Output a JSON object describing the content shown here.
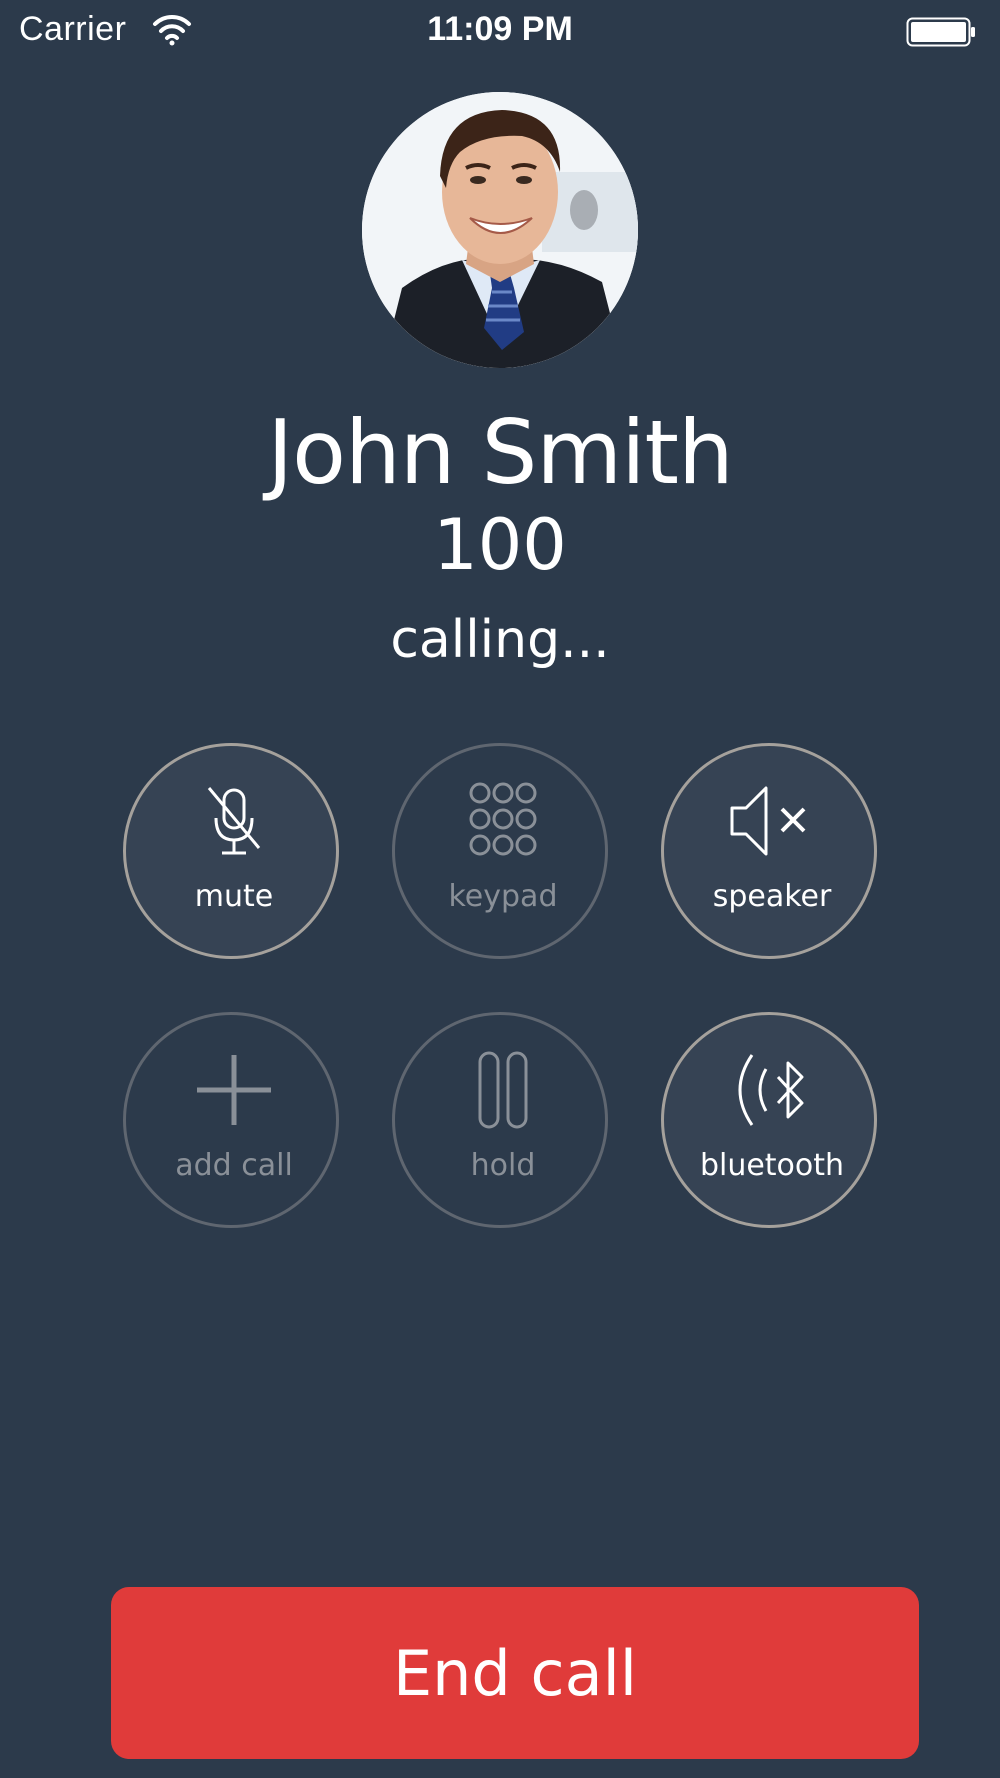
{
  "status_bar": {
    "carrier": "Carrier",
    "time": "11:09 PM",
    "wifi_icon": "wifi-icon",
    "battery_icon": "battery-full-icon"
  },
  "caller": {
    "name": "John Smith",
    "number": "100",
    "status": "calling..."
  },
  "controls": {
    "mute": {
      "label": "mute",
      "icon": "mic-off-icon",
      "enabled": true
    },
    "keypad": {
      "label": "keypad",
      "icon": "keypad-icon",
      "enabled": false
    },
    "speaker": {
      "label": "speaker",
      "icon": "speaker-off-icon",
      "enabled": true
    },
    "add_call": {
      "label": "add call",
      "icon": "plus-icon",
      "enabled": false
    },
    "hold": {
      "label": "hold",
      "icon": "pause-icon",
      "enabled": false
    },
    "bluetooth": {
      "label": "bluetooth",
      "icon": "bluetooth-icon",
      "enabled": true
    }
  },
  "end_call": {
    "label": "End call"
  },
  "colors": {
    "background": "#2c3a4b",
    "end_call": "#e03b3a",
    "active_ring": "#a5a19c",
    "disabled_ring": "#5f6670"
  }
}
